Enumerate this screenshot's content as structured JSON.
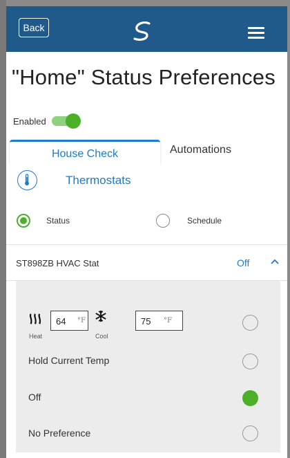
{
  "header": {
    "back_label": "Back"
  },
  "page": {
    "title": "\"Home\" Status Preferences"
  },
  "enabled": {
    "label": "Enabled",
    "on": true
  },
  "tabs": [
    {
      "label": "House Check",
      "active": true
    },
    {
      "label": "Automations",
      "active": false
    }
  ],
  "section": {
    "title": "Thermostats",
    "mode_options": [
      {
        "label": "Status",
        "selected": true
      },
      {
        "label": "Schedule",
        "selected": false
      }
    ]
  },
  "device": {
    "name": "ST898ZB HVAC Stat",
    "state": "Off",
    "expanded": true
  },
  "setpoints": {
    "heat_value": "64",
    "heat_unit": "°F",
    "heat_caption": "Heat",
    "cool_value": "75",
    "cool_unit": "°F",
    "cool_caption": "Cool"
  },
  "preferences": [
    {
      "label": "",
      "selected": false
    },
    {
      "label": "Hold Current Temp",
      "selected": false
    },
    {
      "label": "Off",
      "selected": true
    },
    {
      "label": "No Preference",
      "selected": false
    }
  ],
  "colors": {
    "header_bg": "#1f5a8a",
    "accent_blue": "#1f7ac9",
    "accent_green": "#4caf2a",
    "panel_bg": "#ececec"
  },
  "icons": {
    "menu": "hamburger-menu-icon",
    "logo": "brand-logo-icon",
    "thermostat": "thermometer-icon",
    "chevron": "chevron-up-icon",
    "heat": "heat-waves-icon",
    "cool": "snowflake-icon"
  }
}
